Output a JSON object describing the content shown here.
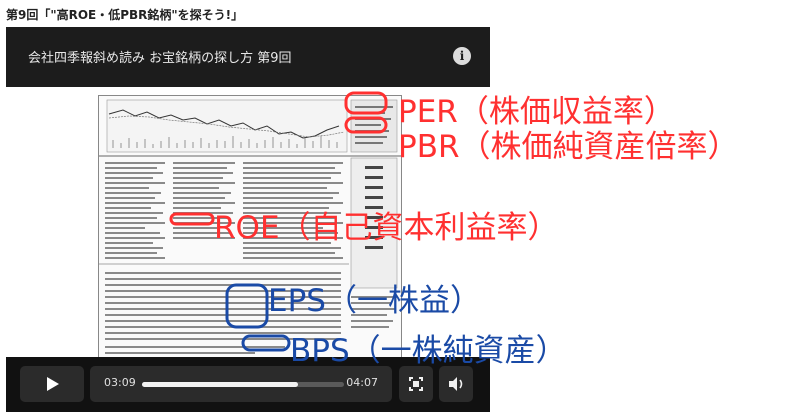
{
  "page": {
    "title": "第9回「\"高ROE・低PBR銘柄\"を探そう!」"
  },
  "player": {
    "title": "会社四季報斜め読み お宝銘柄の探し方 第9回",
    "info_icon": "info-icon",
    "controls": {
      "play_icon": "play-icon",
      "current_time": "03:09",
      "total_time": "04:07",
      "progress": 0.77,
      "fullscreen_icon": "fullscreen-icon",
      "volume_icon": "volume-icon"
    }
  },
  "annotations": {
    "red": [
      "PER（株価収益率）",
      "PBR（株価純資産倍率）",
      "ROE（自己資本利益率）"
    ],
    "blue": [
      "EPS（一株益）",
      "BPS（一株純資産）"
    ],
    "colors": {
      "red": "#ff3030",
      "blue": "#1a4aa6"
    }
  }
}
